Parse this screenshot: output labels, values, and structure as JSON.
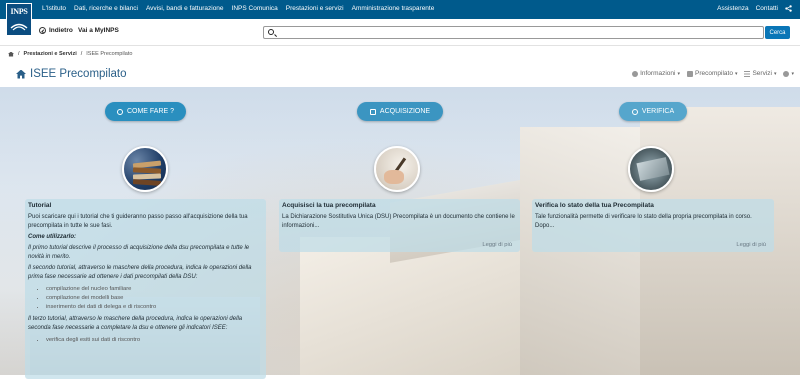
{
  "brand": {
    "logo_text": "INPS"
  },
  "topnav": {
    "items": [
      "L'Istituto",
      "Dati, ricerche e bilanci",
      "Avvisi, bandi e fatturazione",
      "INPS Comunica",
      "Prestazioni e servizi",
      "Amministrazione trasparente"
    ],
    "right": [
      "Assistenza",
      "Contatti"
    ]
  },
  "secbar": {
    "back_label": "Indietro",
    "myinps_label": "Vai a MyINPS",
    "search_placeholder": "",
    "search_button": "Cerca"
  },
  "breadcrumb": {
    "items": [
      "Prestazioni e Servizi",
      "ISEE Precompilato"
    ]
  },
  "page": {
    "title": "ISEE Precompilato"
  },
  "menus": [
    "Informazioni",
    "Precompilato",
    "Servizi"
  ],
  "steps": [
    {
      "label": "COME FARE ?"
    },
    {
      "label": "ACQUISIZIONE"
    },
    {
      "label": "VERIFICA"
    }
  ],
  "cards": {
    "tutorial": {
      "title": "Tutorial",
      "intro": "Puoi scaricare qui i tutorial che ti guideranno passo passo all'acquisizione della tua precompilata in tutte le sue fasi.",
      "how": "Come utilizzarlo:",
      "p1": "Il primo tutorial descrive il processo di acquisizione della dsu precompilata e tutte le novità in merito.",
      "p2": "Il secondo tutorial, attraverso le maschere della procedura, indica le operazioni della prima fase necessarie ad ottenere i dati precompilati della DSU:",
      "list": [
        "compilazione del nucleo familiare",
        "compilazione dei modelli base",
        "inserimento dei dati di delega e di riscontro"
      ],
      "p3": "Il terzo tutorial, attraverso le maschere della procedura, indica le operazioni della seconda fase necessarie a completare la dsu e ottenere gli indicatori ISEE:",
      "list2": [
        "verifica degli esiti sui dati di riscontro"
      ]
    },
    "acquisizione": {
      "title": "Acquisisci la tua precompilata",
      "text": "La Dichiarazione Sostitutiva Unica (DSU) Precompilata è un documento che contiene le informazioni...",
      "more": "Leggi di più"
    },
    "verifica": {
      "title": "Verifica lo stato della tua Precompilata",
      "text": "Tale funzionalità permette di verificare lo stato della propria precompilata in corso. Dopo...",
      "more": "Leggi di più"
    }
  },
  "colors": {
    "topbar": "#005a8c",
    "title": "#2a5f88",
    "pill1": "#2a8fbf",
    "pill2": "#3b95c1",
    "pill3": "#56a6cc",
    "cerca": "#0a76b7"
  }
}
